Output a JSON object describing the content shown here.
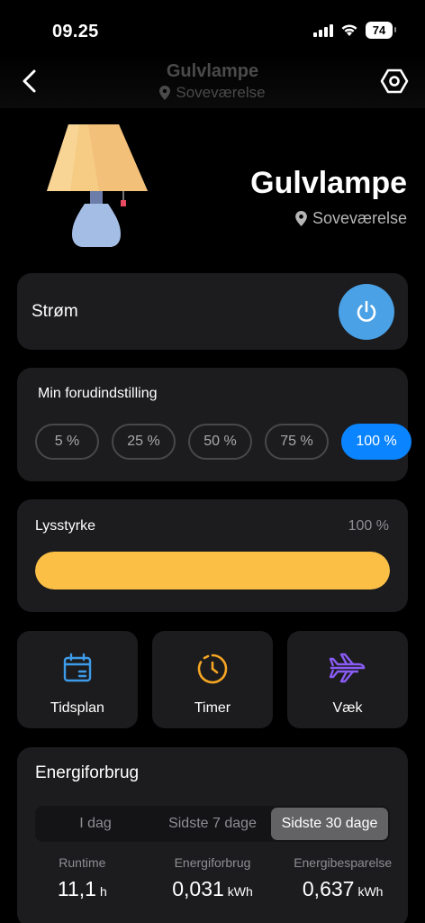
{
  "status": {
    "time": "09.25",
    "battery": "74"
  },
  "nav": {
    "title": "Gulvlampe",
    "subtitle": "Soveværelse"
  },
  "device": {
    "name": "Gulvlampe",
    "room": "Soveværelse"
  },
  "power": {
    "label": "Strøm",
    "on": true
  },
  "presets": {
    "title": "Min forudindstilling",
    "options": [
      "5 %",
      "25 %",
      "50 %",
      "75 %",
      "100 %"
    ],
    "selected": "100 %"
  },
  "brightness": {
    "label": "Lysstyrke",
    "value_text": "100 %",
    "level_percent": 100
  },
  "tiles": {
    "schedule": "Tidsplan",
    "timer": "Timer",
    "away": "Væk"
  },
  "energy": {
    "title": "Energiforbrug",
    "tabs": [
      "I dag",
      "Sidste 7 dage",
      "Sidste 30 dage"
    ],
    "selected_tab": "Sidste 30 dage",
    "stats": [
      {
        "label": "Runtime",
        "value": "11,1",
        "unit": "h"
      },
      {
        "label": "Energiforbrug",
        "value": "0,031",
        "unit": "kWh"
      },
      {
        "label": "Energibesparelse",
        "value": "0,637",
        "unit": "kWh"
      }
    ]
  },
  "colors": {
    "accent_blue": "#0a84ff",
    "power_blue": "#4aa1e6",
    "brightness_yellow": "#fcbf45",
    "card_bg": "#1c1c1e",
    "timer_orange": "#f5a623",
    "away_purple": "#8a5cf6"
  },
  "icons": {
    "back": "chevron-left-icon",
    "settings": "hexagon-settings-icon",
    "location": "location-pin-icon",
    "power": "power-icon",
    "schedule": "calendar-icon",
    "timer": "clock-icon",
    "away": "airplane-icon"
  }
}
